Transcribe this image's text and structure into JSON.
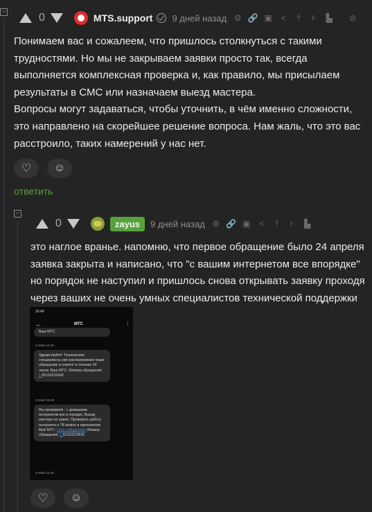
{
  "comment1": {
    "score": "0",
    "author": "MTS.support",
    "time": "9 дней назад",
    "paragraphs": [
      "Понимаем вас и сожалеем, что пришлось столкнуться с такими трудностями. Но мы не закрываем заявки просто так, всегда выполняется комплексная проверка и, как правило, мы присылаем результаты в СМС или назначаем выезд мастера.",
      "Вопросы могут задаваться, чтобы уточнить, в чём именно сложности, это направлено на скорейшее решение вопроса. Нам жаль, что это вас расстроило, таких намерений у нас нет."
    ],
    "reply_label": "ответить",
    "collapse_label": "−"
  },
  "comment2": {
    "score": "0",
    "author": "zayus",
    "time": "9 дней назад",
    "text": "это наглое вранье. напомню, что первое обращение было 24 апреля заявка закрыта и написано, что \"с вашим интернетом все впорядке\" но порядок не наступил и пришлось снова открывать заявку проходя через ваших не очень умных специалистов технической поддержки",
    "collapse_label": "−"
  },
  "phone": {
    "status_time": "16:49",
    "title": "МТС",
    "bubble0": "Ваш МТС.",
    "time1": "4 Май 12:49",
    "bubble1": "Здравствуйте! Технические специалисты уже рассматривают ваше обращение и ответят в течение 24 часов. Ваш МТС. //Номер обращения:",
    "bubble1_num": "1-",
    "bubble1_num2": "82110210642",
    "time2": "4 Май 19:48",
    "bubble2": "Мы проверили - с домашним интернетом всё в порядке. Выезд мастера не нужен. Проверить работу интернета и ТВ можно в приложении Мой МТС:",
    "bubble2_link": "l.mts.ru/diagnostic",
    "bubble2_tail": "//Номер обращения:",
    "bubble2_num": "1-",
    "bubble2_num2": "82110210642",
    "time3": "5 Май 12:49"
  },
  "icons": {
    "tools": [
      "emoji-icon",
      "link-icon",
      "save-icon",
      "share-icon",
      "pin-icon",
      "thread-icon",
      "flag-icon"
    ]
  },
  "colors": {
    "accent": "#56a33c",
    "avatar2": "#86a332",
    "avatar1": "#e32b2b"
  }
}
